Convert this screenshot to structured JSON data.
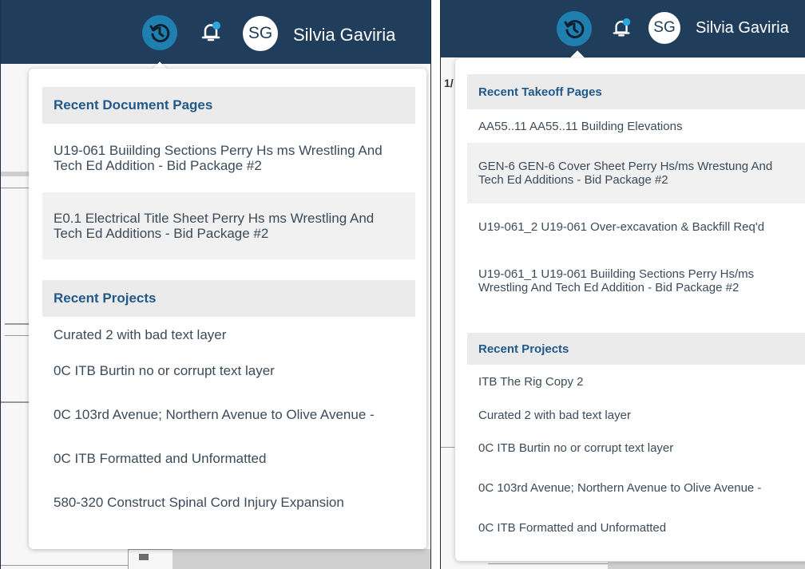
{
  "colors": {
    "topbar": "#203e5c",
    "history_button": "#1f7fae",
    "notification_dot": "#29a8e0",
    "section_header_text": "#215a8a",
    "item_text": "#3c4b59"
  },
  "left": {
    "user": {
      "initials": "SG",
      "name": "Silvia Gaviria"
    },
    "icons": [
      "history-icon",
      "bell-icon"
    ],
    "doc_label": "1/",
    "recent_document_pages": {
      "title": "Recent Document Pages",
      "items": [
        "U19-061 Buiilding Sections Perry Hs ms Wrestling And Tech Ed Addition - Bid Package #2",
        "E0.1 Electrical Title Sheet Perry Hs ms Wrestling And Tech Ed Additions - Bid Package #2"
      ]
    },
    "recent_projects": {
      "title": "Recent Projects",
      "items": [
        "Curated 2 with bad text layer",
        "0C ITB Burtin no or corrupt text layer",
        "0C 103rd Avenue; Northern Avenue to Olive Avenue -",
        "0C ITB Formatted and Unformatted",
        "580-320 Construct Spinal Cord Injury Expansion"
      ]
    }
  },
  "right": {
    "user": {
      "initials": "SG",
      "name": "Silvia Gaviria"
    },
    "recent_takeoff_pages": {
      "title": "Recent Takeoff Pages",
      "items": [
        "AA55..11 AA55..11 Building Elevations",
        "GEN-6 GEN-6 Cover Sheet Perry Hs/ms Wrestung And Tech Ed Additions - Bid Package #2",
        "U19-061_2 U19-061 Over-excavation & Backfill Req'd",
        "U19-061_1 U19-061 Buiilding Sections Perry Hs/ms Wrestling And Tech Ed Addition - Bid Package #2"
      ]
    },
    "recent_projects": {
      "title": "Recent Projects",
      "items": [
        "ITB The Rig Copy 2",
        "Curated 2 with bad text layer",
        "0C ITB Burtin no or corrupt text layer",
        "0C 103rd Avenue; Northern Avenue to Olive Avenue -",
        "0C ITB Formatted and Unformatted"
      ]
    }
  }
}
